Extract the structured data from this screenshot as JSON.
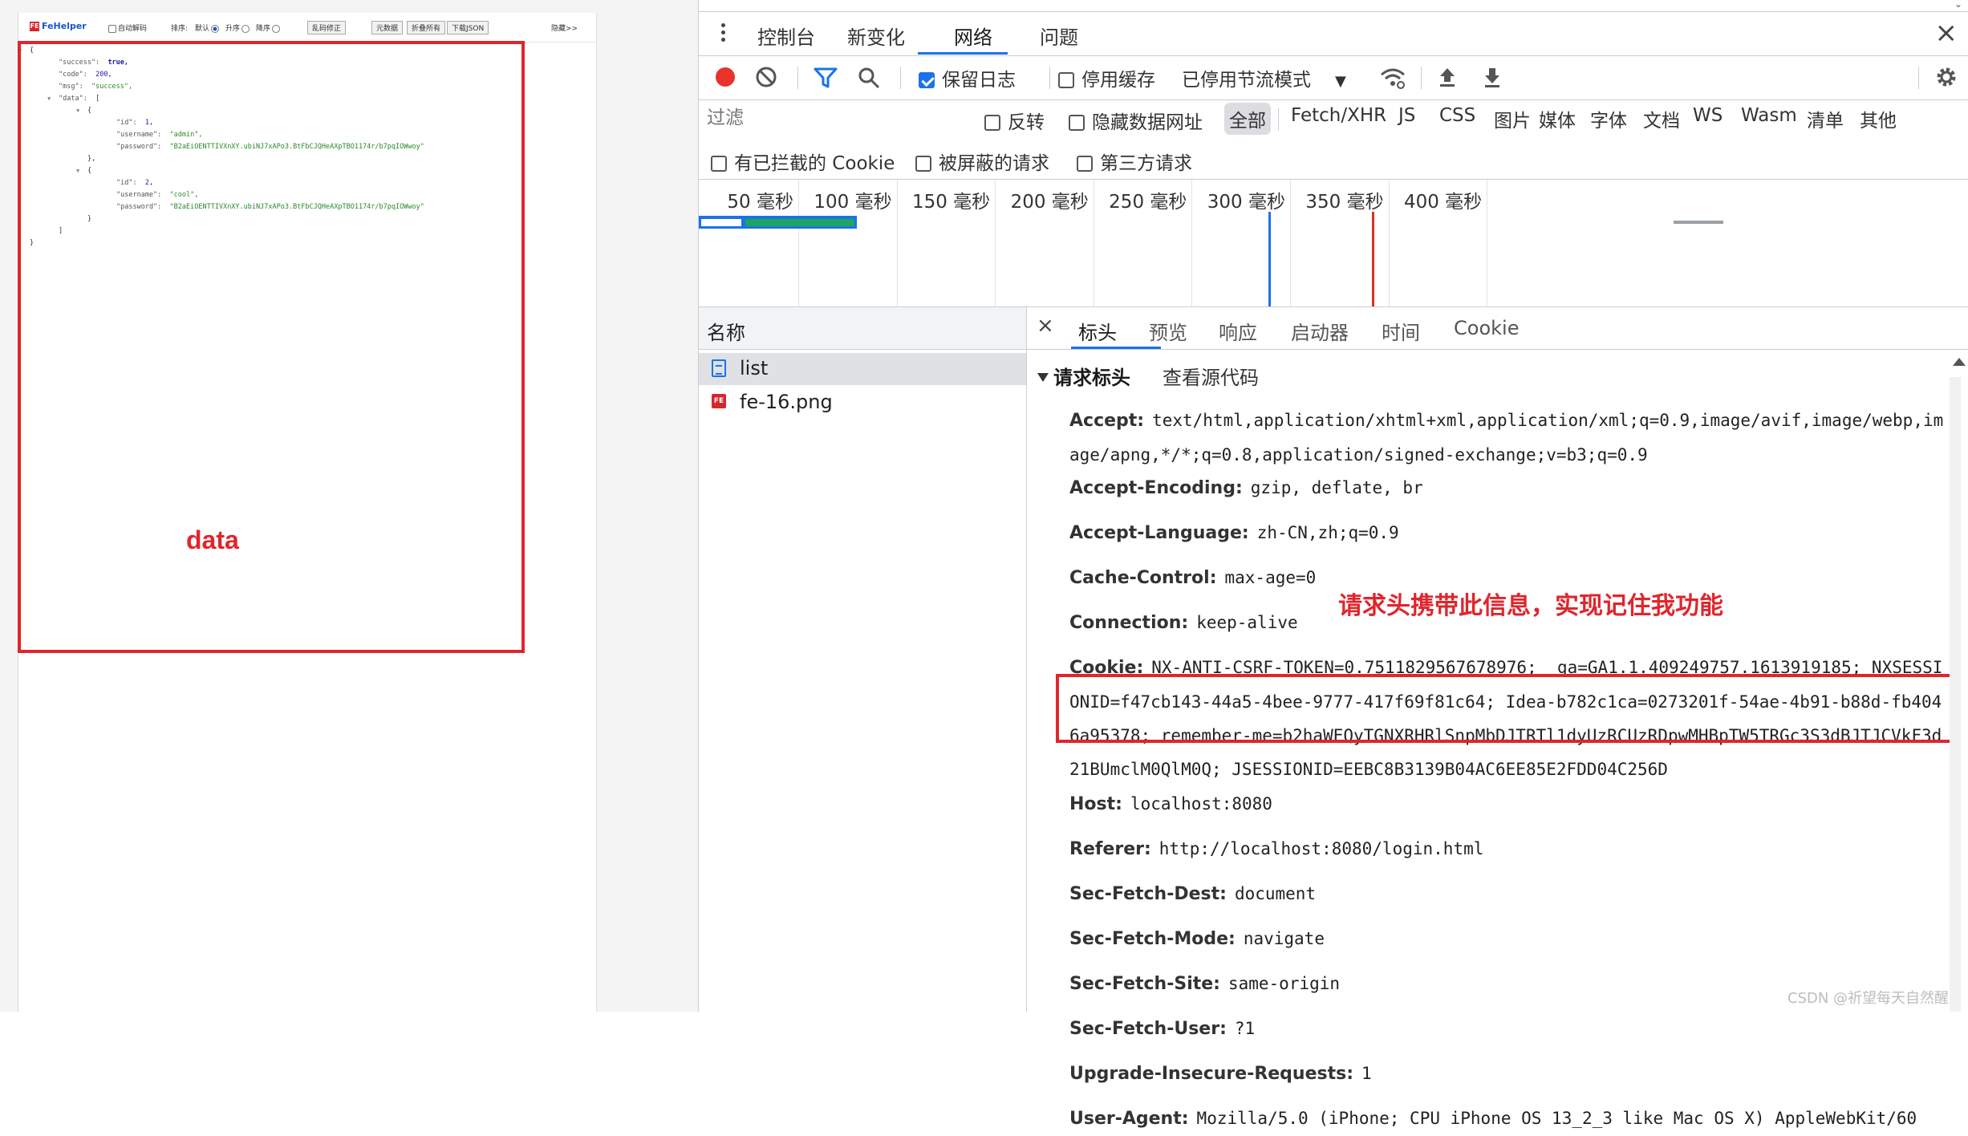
{
  "fehelper": {
    "logo": "FeHelper",
    "auto_decode": "自动解码",
    "sort_label": "排序:",
    "sort_default": "默认",
    "sort_asc": "升序",
    "sort_desc": "降序",
    "fix_garbled": "乱码修正",
    "btn_fullscreen": "元数据",
    "btn_fold_all": "折叠所有",
    "btn_download": "下载JSON",
    "hide": "隐藏>>"
  },
  "json_view": {
    "lines": [
      {
        "text": "{",
        "indent": 0,
        "toggle": "▼"
      },
      {
        "key": "\"success\":",
        "value": "true,",
        "vtype": "bool",
        "indent": 1
      },
      {
        "key": "\"code\":",
        "value": "200,",
        "vtype": "num",
        "indent": 1
      },
      {
        "key": "\"msg\":",
        "value": "\"success\",",
        "vtype": "str",
        "indent": 1
      },
      {
        "key": "\"data\":",
        "value": "[",
        "vtype": "punct",
        "indent": 1,
        "toggle": "▼"
      },
      {
        "text": "{",
        "indent": 2,
        "toggle": "▼"
      },
      {
        "key": "\"id\":",
        "value": "1,",
        "vtype": "num",
        "indent": 3
      },
      {
        "key": "\"username\":",
        "value": "\"admin\",",
        "vtype": "str",
        "indent": 3
      },
      {
        "key": "\"password\":",
        "value": "\"B2aEiOENTTIVXnXY.ubiNJ7xAPo3.BtFbCJQHeAXpTBO1174r/b7pqIOWwoy\"",
        "vtype": "str",
        "indent": 3
      },
      {
        "text": "},",
        "indent": 2
      },
      {
        "text": "{",
        "indent": 2,
        "toggle": "▼"
      },
      {
        "key": "\"id\":",
        "value": "2,",
        "vtype": "num",
        "indent": 3
      },
      {
        "key": "\"username\":",
        "value": "\"cool\",",
        "vtype": "str",
        "indent": 3
      },
      {
        "key": "\"password\":",
        "value": "\"B2aEiOENTTIVXnXY.ubiNJ7xAPo3.BtFbCJQHeAXpTBO1174r/b7pqIOWwoy\"",
        "vtype": "str",
        "indent": 3
      },
      {
        "text": "}",
        "indent": 2
      },
      {
        "text": "]",
        "indent": 1
      },
      {
        "text": "}",
        "indent": 0
      }
    ]
  },
  "annotations": {
    "data_label": "data",
    "cookie_note": "请求头携带此信息，实现记住我功能",
    "watermark": "CSDN @祈望每天自然醒"
  },
  "devtools": {
    "tabs": [
      "控制台",
      "新变化",
      "网络",
      "问题"
    ],
    "active_tab": "网络",
    "toolbar": {
      "preserve_log": "保留日志",
      "disable_cache": "停用缓存",
      "throttling": "已停用节流模式"
    },
    "filter": {
      "placeholder": "过滤",
      "invert": "反转",
      "hide_data_urls": "隐藏数据网址",
      "types": [
        "全部",
        "Fetch/XHR",
        "JS",
        "CSS",
        "图片",
        "媒体",
        "字体",
        "文档",
        "WS",
        "Wasm",
        "清单",
        "其他"
      ],
      "blocked_cookies": "有已拦截的 Cookie",
      "blocked_requests": "被屏蔽的请求",
      "third_party": "第三方请求"
    },
    "timeline_ticks": [
      "50 毫秒",
      "100 毫秒",
      "150 毫秒",
      "200 毫秒",
      "250 毫秒",
      "300 毫秒",
      "350 毫秒",
      "400 毫秒"
    ],
    "name_column": "名称",
    "requests": [
      {
        "name": "list",
        "type": "document",
        "selected": true
      },
      {
        "name": "fe-16.png",
        "type": "image",
        "selected": false
      }
    ],
    "detail_tabs": [
      "标头",
      "预览",
      "响应",
      "启动器",
      "时间",
      "Cookie"
    ],
    "active_detail_tab": "标头",
    "section_title": "请求标头",
    "view_source": "查看源代码",
    "headers": [
      {
        "name": "Accept:",
        "value": "text/html,application/xhtml+xml,application/xml;q=0.9,image/avif,image/webp,image/apng,*/*;q=0.8,application/signed-exchange;v=b3;q=0.9"
      },
      {
        "name": "Accept-Encoding:",
        "value": "gzip, deflate, br"
      },
      {
        "name": "Accept-Language:",
        "value": "zh-CN,zh;q=0.9"
      },
      {
        "name": "Cache-Control:",
        "value": "max-age=0"
      },
      {
        "name": "Connection:",
        "value": "keep-alive"
      },
      {
        "name": "Cookie:",
        "value": "NX-ANTI-CSRF-TOKEN=0.7511829567678976; _ga=GA1.1.409249757.1613919185; NXSESSIONID=f47cb143-44a5-4bee-9777-417f69f81c64; Idea-b782c1ca=0273201f-54ae-4b91-b88d-fb4046a95378; remember-me=b2haWEQyTGNXRHRlSnpMbDJTRTl1dyUzRCUzRDpwMHBpTW5TRGc3S3dBJTJCVkF3d21BUmclM0QlM0Q; JSESSIONID=EEBC8B3139B04AC6EE85E2FDD04C256D"
      },
      {
        "name": "Host:",
        "value": "localhost:8080"
      },
      {
        "name": "Referer:",
        "value": "http://localhost:8080/login.html"
      },
      {
        "name": "Sec-Fetch-Dest:",
        "value": "document"
      },
      {
        "name": "Sec-Fetch-Mode:",
        "value": "navigate"
      },
      {
        "name": "Sec-Fetch-Site:",
        "value": "same-origin"
      },
      {
        "name": "Sec-Fetch-User:",
        "value": "?1"
      },
      {
        "name": "Upgrade-Insecure-Requests:",
        "value": "1"
      },
      {
        "name": "User-Agent:",
        "value": "Mozilla/5.0 (iPhone; CPU iPhone OS 13_2_3 like Mac OS X) AppleWebKit/60"
      }
    ]
  },
  "colors": {
    "record": "#e8322c",
    "accent": "#1a73e8",
    "annotation_red": "#e0252c",
    "json_string": "#2a8a2a"
  }
}
